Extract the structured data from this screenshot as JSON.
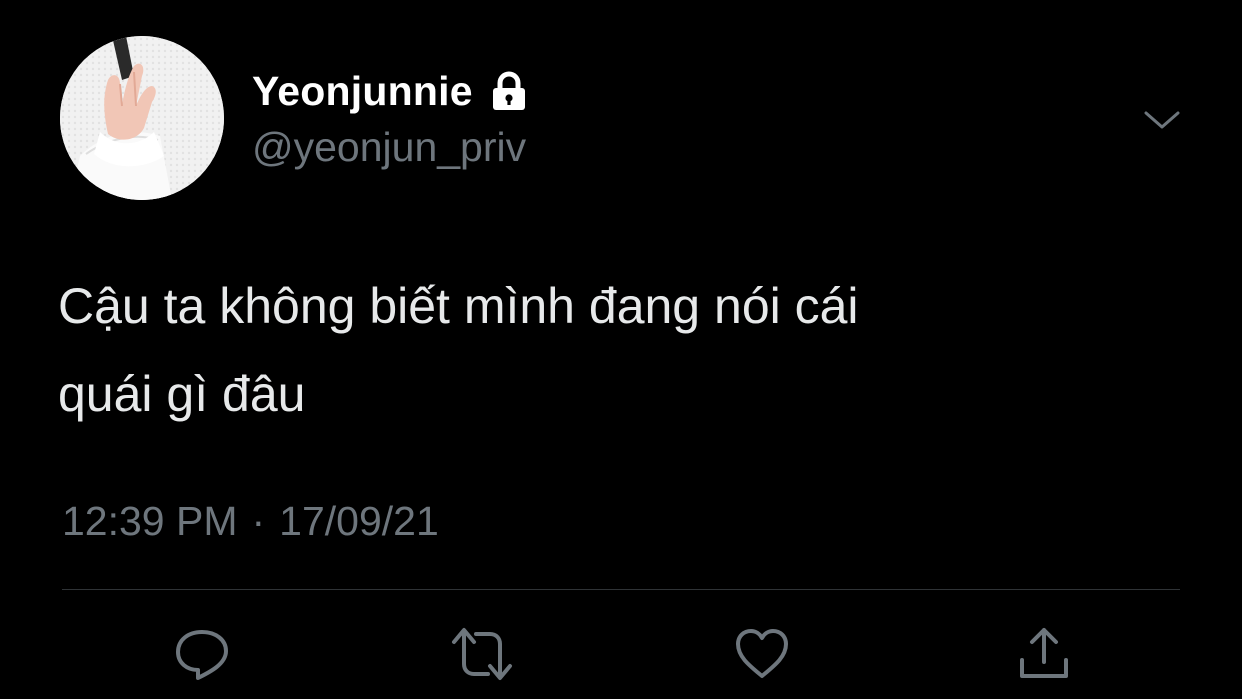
{
  "user": {
    "display_name": "Yeonjunnie",
    "handle": "@yeonjun_priv",
    "avatar_icon": "avatar-hand-photo",
    "protected_icon": "lock-icon"
  },
  "tweet": {
    "text": "Cậu ta không biết mình đang nói cái\nquái gì đâu",
    "time": "12:39 PM",
    "separator": "·",
    "date": "17/09/21"
  },
  "icons": {
    "more": "chevron-down-icon",
    "reply": "reply-icon",
    "retweet": "retweet-icon",
    "like": "like-icon",
    "share": "share-icon"
  },
  "colors": {
    "background": "#000000",
    "primary_text": "#e7e9ea",
    "secondary_text": "#6e767d",
    "divider": "#2f3336"
  }
}
